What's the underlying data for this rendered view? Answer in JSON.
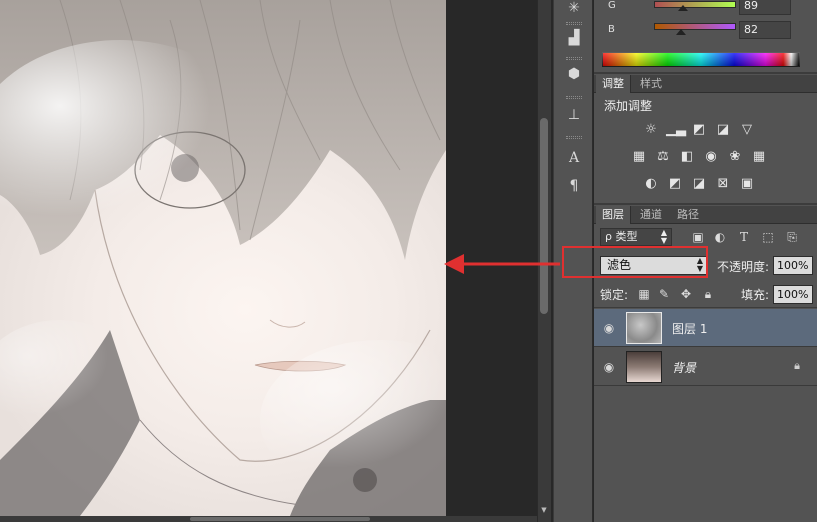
{
  "color_panel": {
    "g_label": "G",
    "g_value": "89",
    "b_label": "B",
    "b_value": "82"
  },
  "adjust_panel": {
    "tabs": [
      "调整",
      "样式"
    ],
    "title": "添加调整"
  },
  "layers_panel": {
    "tabs": [
      "图层",
      "通道",
      "路径"
    ],
    "filter_label": "ρ 类型",
    "blend_mode": "滤色",
    "opacity_label": "不透明度:",
    "opacity_value": "100%",
    "lock_label": "锁定:",
    "fill_label": "填充:",
    "fill_value": "100%",
    "layers": [
      {
        "name": "图层 1",
        "selected": true
      },
      {
        "name": "背景",
        "selected": false
      }
    ]
  },
  "icons": {
    "tools": [
      "asterisk-tool-icon",
      "histogram-tool-icon",
      "cube-tool-icon",
      "stamp-tool-icon",
      "character-icon",
      "paragraph-icon"
    ],
    "annotation_color": "#e03030"
  }
}
